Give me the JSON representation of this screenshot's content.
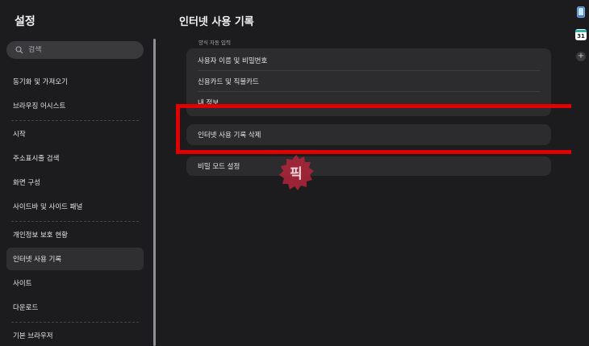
{
  "sidebar": {
    "title": "설정",
    "search": {
      "placeholder": "검색"
    },
    "items": [
      {
        "label": "동기화 및 가져오기"
      },
      {
        "label": "브라우징 어시스트"
      },
      {
        "label": "시작"
      },
      {
        "label": "주소표시줄 검색"
      },
      {
        "label": "화면 구성"
      },
      {
        "label": "사이드바 및 사이드 패널"
      },
      {
        "label": "개인정보 보호 현황"
      },
      {
        "label": "인터넷 사용 기록"
      },
      {
        "label": "사이트"
      },
      {
        "label": "다운로드"
      },
      {
        "label": "기본 브라우저"
      }
    ]
  },
  "main": {
    "title": "인터넷 사용 기록",
    "autofill": {
      "section_label": "양식 자동 입력",
      "rows": [
        {
          "label": "사용자 이름 및 비밀번호"
        },
        {
          "label": "신용카드 및 직불카드"
        },
        {
          "label": "내 정보"
        }
      ]
    },
    "delete_history_label": "인터넷 사용 기록 삭제",
    "secret_mode_label": "비밀 모드 설정"
  },
  "right_strip": {
    "calendar_day": "31"
  },
  "watermark": {
    "text": "픽"
  },
  "colors": {
    "background": "#1c1c1e",
    "card": "#2c2c2e",
    "highlight": "#e00000",
    "watermark": "#b0243a"
  }
}
